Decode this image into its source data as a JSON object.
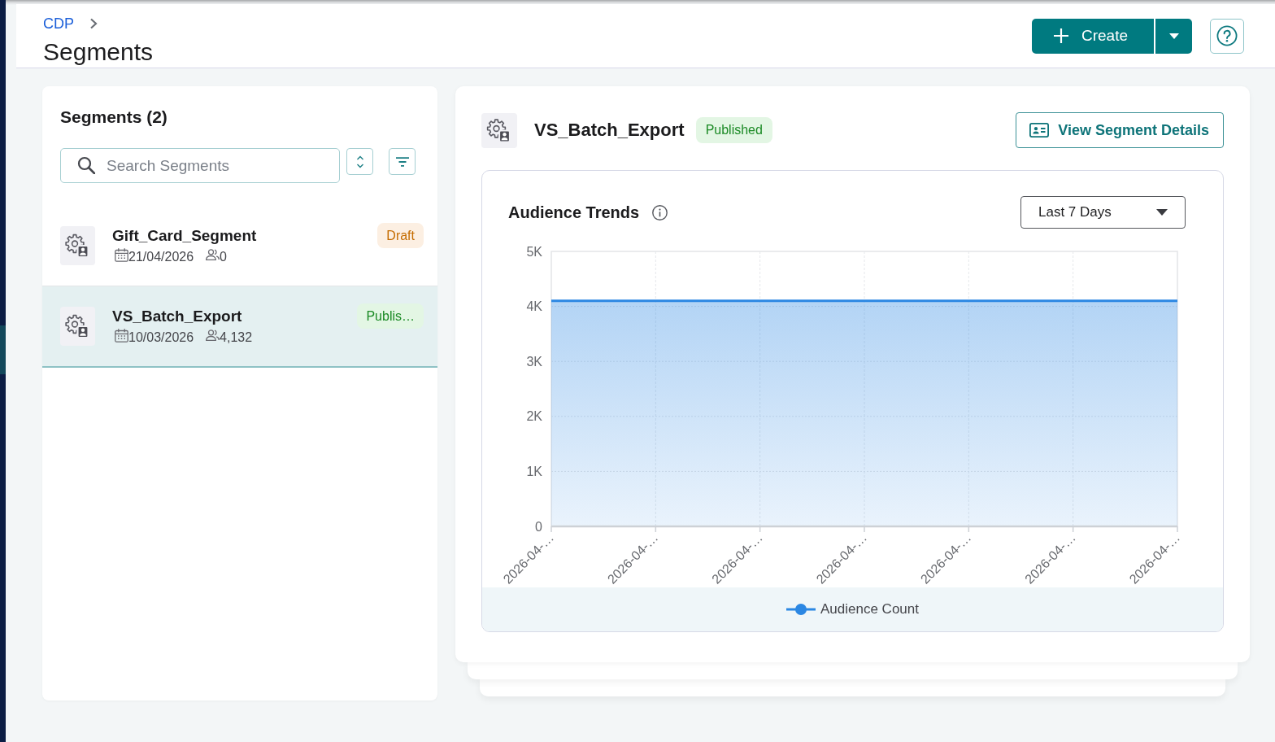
{
  "header": {
    "breadcrumb": [
      {
        "label": "CDP"
      }
    ],
    "title": "Segments",
    "create_button": {
      "label": "Create"
    }
  },
  "segment_list": {
    "title": "Segments (2)",
    "search": {
      "placeholder": "Search Segments"
    },
    "items": [
      {
        "name": "Gift_Card_Segment",
        "date": "21/04/2026",
        "audience": "0",
        "status": {
          "label": "Draft",
          "kind": "draft"
        },
        "selected": false
      },
      {
        "name": "VS_Batch_Export",
        "date": "10/03/2026",
        "audience": "4,132",
        "status": {
          "label": "Publis…",
          "kind": "published"
        },
        "selected": true
      }
    ]
  },
  "detail": {
    "name": "VS_Batch_Export",
    "status": {
      "label": "Published",
      "kind": "published"
    },
    "view_button": {
      "label": "View Segment Details"
    },
    "trends": {
      "title": "Audience Trends",
      "range": "Last 7 Days",
      "chart_data": {
        "type": "area",
        "categories": [
          "2026-04-…",
          "2026-04-…",
          "2026-04-…",
          "2026-04-…",
          "2026-04-…",
          "2026-04-…",
          "2026-04-…"
        ],
        "series": [
          {
            "name": "Audience Count",
            "color": "#2b87e3",
            "values": [
              4100,
              4100,
              4100,
              4100,
              4100,
              4100,
              4100
            ]
          }
        ],
        "ylim": [
          0,
          5000
        ],
        "yticks": [
          0,
          {
            "value": 1000,
            "label": "1K"
          },
          {
            "value": 2000,
            "label": "2K"
          },
          {
            "value": 3000,
            "label": "3K"
          },
          {
            "value": 4000,
            "label": "4K"
          },
          {
            "value": 5000,
            "label": "5K"
          }
        ],
        "grid": true
      }
    }
  }
}
